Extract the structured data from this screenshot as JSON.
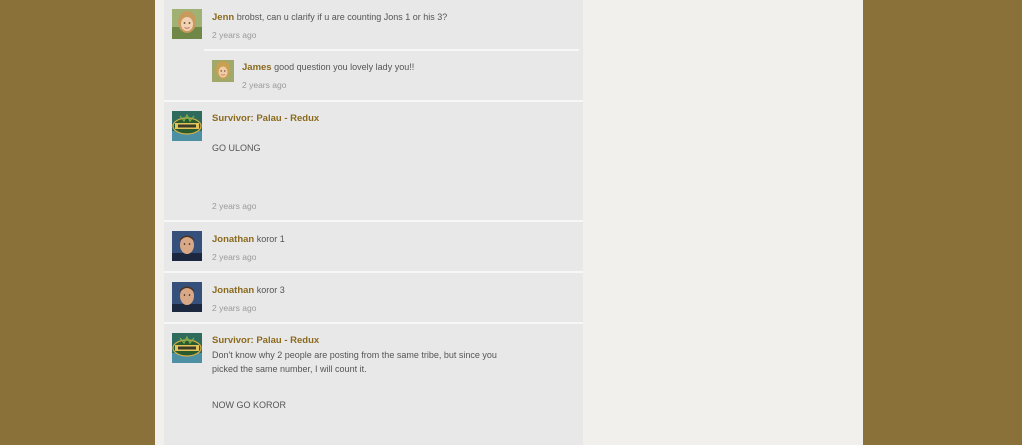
{
  "comments": [
    {
      "author": "Jenn",
      "avatar": "woman-portrait-avatar",
      "text": "brobst, can u clarify if u are counting Jons 1 or his 3?",
      "time": "2 years ago",
      "reply": {
        "author": "James",
        "avatar": "woman-portrait-avatar",
        "text": "good question you lovely lady you!!",
        "time": "2 years ago"
      }
    },
    {
      "author": "Survivor: Palau - Redux",
      "avatar": "survivor-palau-logo",
      "text": "GO ULONG",
      "time": "2 years ago"
    },
    {
      "author": "Jonathan",
      "avatar": "man-portrait-avatar",
      "text": "koror 1",
      "time": "2 years ago"
    },
    {
      "author": "Jonathan",
      "avatar": "man-portrait-avatar",
      "text": "koror 3",
      "time": "2 years ago"
    },
    {
      "author": "Survivor: Palau - Redux",
      "avatar": "survivor-palau-logo",
      "line1": "Don't know why 2 people are posting from the same tribe, but since you",
      "line2": "picked the same number, I will count it.",
      "line3": "NOW GO KOROR"
    }
  ]
}
